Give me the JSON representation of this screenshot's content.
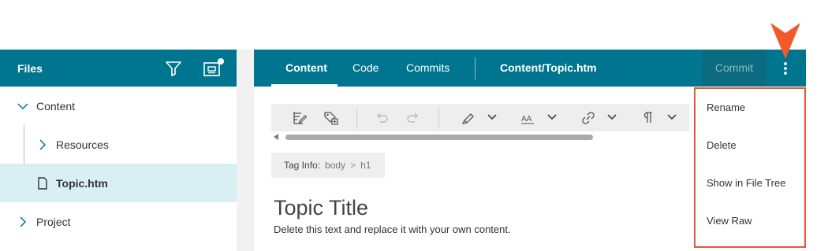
{
  "files_panel": {
    "title": "Files",
    "tree": [
      {
        "label": "Content",
        "expanded": true
      },
      {
        "label": "Resources",
        "expanded": false
      },
      {
        "label": "Topic.htm",
        "selected": true
      },
      {
        "label": "Project",
        "expanded": false
      }
    ]
  },
  "editor": {
    "tabs": [
      "Content",
      "Code",
      "Commits"
    ],
    "active_tab": "Content",
    "file_path": "Content/Topic.htm",
    "commit_label": "Commit",
    "tag_info": {
      "label": "Tag Info:",
      "crumbs": [
        "body",
        "h1"
      ],
      "separator": ">"
    },
    "document": {
      "title": "Topic Title",
      "body": "Delete this text and replace it with your own content."
    }
  },
  "menu": {
    "items": [
      "Rename",
      "Delete",
      "Show in File Tree",
      "View Raw"
    ]
  },
  "colors": {
    "header_bg": "#00758f",
    "selected_row": "#d8eff4",
    "highlight_border": "#e05a3a",
    "pointer": "#f05a28"
  },
  "icons": [
    "filter-icon",
    "new-file-icon",
    "chevron-down-icon",
    "chevron-right-icon",
    "file-icon",
    "more-vertical-icon",
    "edit-icon",
    "tag-icon",
    "undo-icon",
    "redo-icon",
    "highlighter-icon",
    "font-size-icon",
    "link-icon",
    "paragraph-icon"
  ]
}
